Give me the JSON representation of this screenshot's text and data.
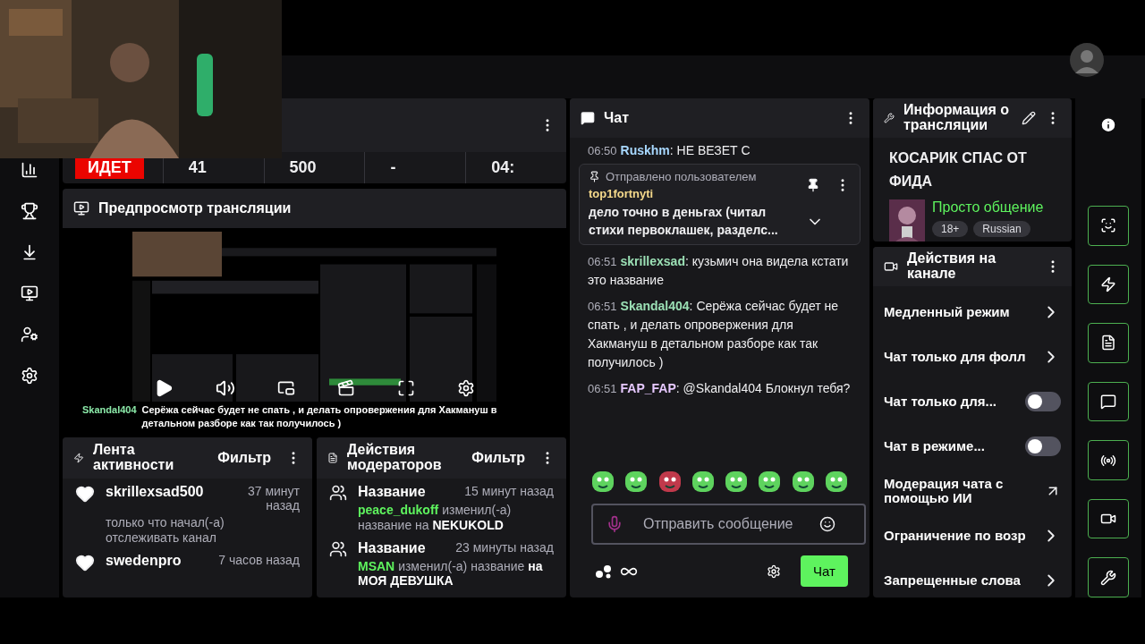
{
  "stats": {
    "cells": [
      {
        "text": "ИДЕТ",
        "kind": "live"
      },
      {
        "text": "41",
        "kind": "plain"
      },
      {
        "text": "500",
        "kind": "plain"
      },
      {
        "text": "-",
        "kind": "plain"
      },
      {
        "text": "04:",
        "kind": "plain"
      }
    ]
  },
  "preview": {
    "title": "Предпросмотр трансляции",
    "caption_user": "Skandal404",
    "caption_text": "Серёжа сейчас будет не спать , и делать опровержения для Хакмануш в детальном разборе как так получилось )"
  },
  "activity": {
    "title": "Лента активности",
    "filter": "Фильтр",
    "items": [
      {
        "user": "skrillexsad500",
        "time": "37 минут назад",
        "text": "только что начал(-а) отслеживать канал"
      },
      {
        "user": "swedenpro",
        "time": "7 часов назад"
      }
    ]
  },
  "mod_actions": {
    "title": "Действия модераторов",
    "filter": "Фильтр",
    "items": [
      {
        "action": "Название",
        "time": "15 минут назад",
        "user": "peace_dukoff",
        "text": "изменил(-а) название на",
        "value": "NEKUKOLD"
      },
      {
        "action": "Название",
        "time": "23 минуты назад",
        "user": "MSAN",
        "text": "изменил(-а) название",
        "value": "на МОЯ ДЕВУШКА"
      }
    ]
  },
  "chat": {
    "title": "Чат",
    "pinned": {
      "label": "Отправлено пользователем",
      "user": "top1fortnyti",
      "text": "дело точно в деньгах (читал стихи первоклашек, разделс..."
    },
    "messages": [
      {
        "time": "06:50",
        "user": "Ruskhm",
        "color": "#a8d8ff",
        "text": "НЕ ВЕЗЕТ С"
      },
      {
        "time": "06:51",
        "user": "skrillexsad",
        "color": "#9be0b5",
        "text": "кузьмич она видела кстати это название"
      },
      {
        "time": "06:51",
        "user": "Skandal404",
        "color": "#9be0b5",
        "text": "Серёжа сейчас будет не спать , и делать опровержения для Хакмануш в детальном разборе как так получилось )"
      },
      {
        "time": "06:51",
        "user": "FAP_FAP",
        "color": "#e6c8ff",
        "text": "@Skandal404 Блокнул тебя?"
      }
    ],
    "separator": ":",
    "placeholder": "Отправить сообщение",
    "send": "Чат"
  },
  "stream_info": {
    "title": "Информация о трансляции",
    "stream_title": "КОСАРИК СПАС ОТ ФИДА",
    "category": "Просто общение",
    "tags": [
      "18+",
      "Russian"
    ]
  },
  "channel_actions": {
    "title": "Действия на канале",
    "items": [
      {
        "label": "Медленный режим",
        "kind": "link"
      },
      {
        "label": "Чат только для фолл",
        "kind": "link"
      },
      {
        "label": "Чат только для...",
        "kind": "toggle",
        "on": false
      },
      {
        "label": "Чат в режиме...",
        "kind": "toggle",
        "on": false
      },
      {
        "label": "Модерация чата с помощью ИИ",
        "kind": "external"
      },
      {
        "label": "Ограничение по возр",
        "kind": "link"
      },
      {
        "label": "Запрещенные слова",
        "kind": "link"
      }
    ]
  }
}
